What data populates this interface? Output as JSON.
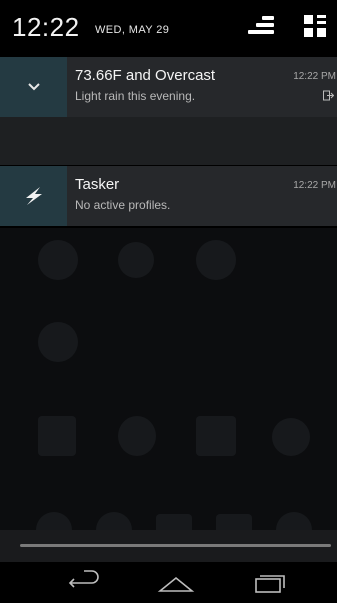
{
  "status_bar": {
    "time": "12:22",
    "date": "WED, MAY 29"
  },
  "notifications": [
    {
      "title": "73.66F and Overcast",
      "subtitle": "Light rain this evening.",
      "time": "12:22 PM",
      "icon": "chevron-down-icon"
    },
    {
      "title": "Tasker",
      "subtitle": "No active profiles.",
      "time": "12:22 PM",
      "icon": "lightning-bolt-icon"
    }
  ],
  "colors": {
    "notification_bg": "#26282b",
    "icon_box_bg": "#243a42"
  }
}
